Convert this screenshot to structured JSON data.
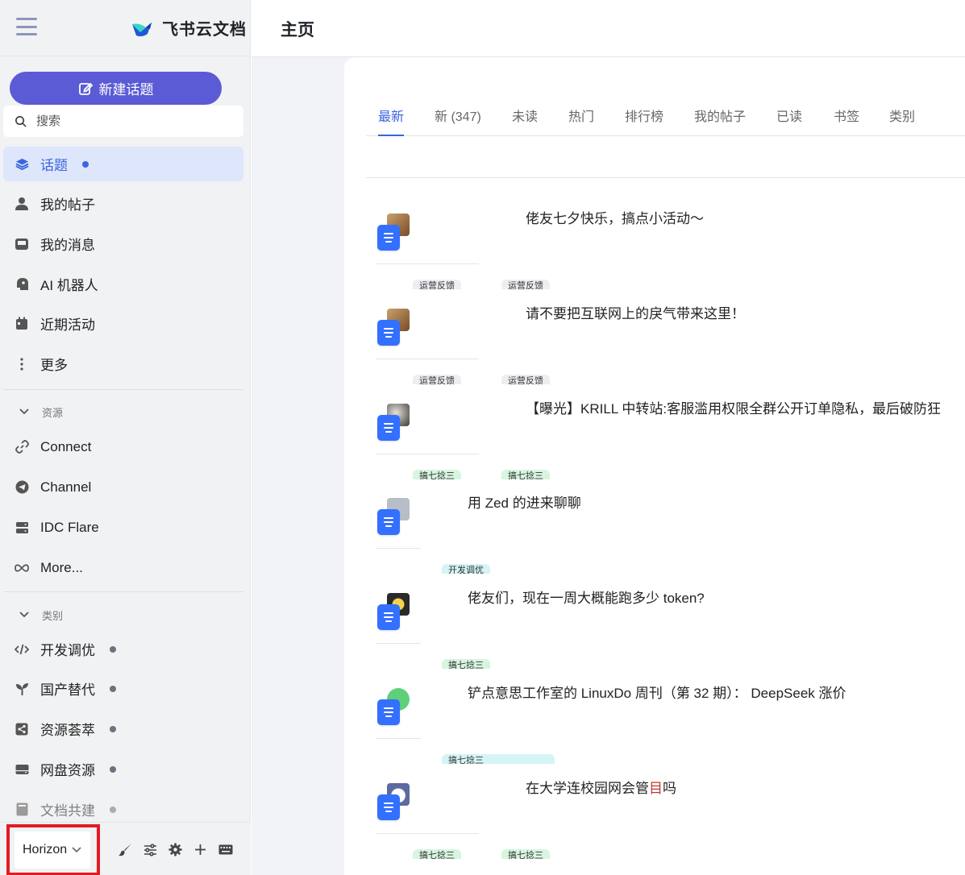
{
  "brand": {
    "name": "飞书云文档"
  },
  "header": {
    "title": "主页"
  },
  "sidebar": {
    "new_topic_label": "新建话题",
    "search_placeholder": "搜索",
    "nav": [
      {
        "label": "话题",
        "icon": "layers-icon",
        "active": true
      },
      {
        "label": "我的帖子",
        "icon": "user-icon"
      },
      {
        "label": "我的消息",
        "icon": "inbox-icon"
      },
      {
        "label": "AI 机器人",
        "icon": "robot-icon"
      },
      {
        "label": "近期活动",
        "icon": "calendar-icon"
      },
      {
        "label": "更多",
        "icon": "more-vertical-icon"
      }
    ],
    "resources_heading": "资源",
    "resources": [
      {
        "label": "Connect",
        "icon": "link-icon"
      },
      {
        "label": "Channel",
        "icon": "telegram-icon"
      },
      {
        "label": "IDC Flare",
        "icon": "server-icon"
      },
      {
        "label": "More...",
        "icon": "infinity-icon"
      }
    ],
    "categories_heading": "类别",
    "categories": [
      {
        "label": "开发调优",
        "icon": "code-icon"
      },
      {
        "label": "国产替代",
        "icon": "sprout-icon"
      },
      {
        "label": "资源荟萃",
        "icon": "share-icon"
      },
      {
        "label": "网盘资源",
        "icon": "hdd-icon"
      },
      {
        "label": "文档共建",
        "icon": "book-icon"
      }
    ],
    "footer": {
      "theme_label": "Horizon"
    }
  },
  "tabs": [
    "最新",
    "新 (347)",
    "未读",
    "热门",
    "排行榜",
    "我的帖子",
    "已读",
    "书签",
    "类别"
  ],
  "topics": [
    {
      "title": "佬友七夕快乐，搞点小活动～",
      "tags": [
        "运营反馈",
        "运营反馈"
      ]
    },
    {
      "title": "请不要把互联网上的戾气带来这里！",
      "tags": [
        "运营反馈",
        "运营反馈"
      ]
    },
    {
      "title": "【曝光】KRILL 中转站:客服滥用权限全群公开订单隐私，最后破防狂",
      "tags": [
        "搞七捻三",
        "搞七捻三"
      ]
    },
    {
      "title": "用 Zed 的进来聊聊",
      "tags": [
        "开发调优"
      ]
    },
    {
      "title": "佬友们，现在一周大概能跑多少 token?",
      "tags": [
        "搞七捻三"
      ]
    },
    {
      "title": "铲点意思工作室的 LinuxDo 周刊（第 32 期）： DeepSeek 涨价",
      "tags": [
        "搞七捻三"
      ]
    },
    {
      "title": "在大学连校园网会管",
      "title_em": "目",
      "title_tail": "吗",
      "tags": [
        "搞七捻三",
        "搞七捻三"
      ]
    }
  ],
  "colors": {
    "accent": "#3a64e0",
    "new_button": "#5b5bd6",
    "doc_badge": "#3370ff",
    "highlight_box": "#e31b23"
  }
}
